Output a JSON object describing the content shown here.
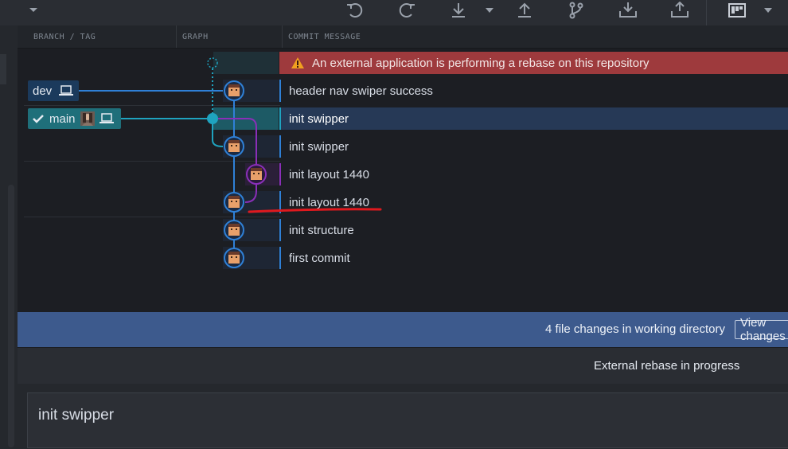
{
  "toolbar": {
    "icons": [
      "chevron-down-icon",
      "undo-icon",
      "redo-icon",
      "pull-icon",
      "push-icon",
      "branch-icon",
      "stash-icon",
      "pop-icon",
      "layout-icon"
    ]
  },
  "columns": {
    "branch_tag": "BRANCH / TAG",
    "graph": "GRAPH",
    "commit_message": "COMMIT MESSAGE"
  },
  "warning": {
    "text": "An external application is performing a rebase on this repository",
    "color": "#9e3a3d"
  },
  "branches": [
    {
      "name": "dev",
      "checked": false
    },
    {
      "name": "main",
      "checked": true
    }
  ],
  "commits": [
    {
      "message": "header nav swiper success",
      "lane": "blue"
    },
    {
      "message": "init swipper",
      "lane": "teal",
      "selected": true
    },
    {
      "message": "init swipper",
      "lane": "blue"
    },
    {
      "message": "init layout 1440",
      "lane": "purple"
    },
    {
      "message": "init layout 1440",
      "lane": "blue",
      "annotated": true
    },
    {
      "message": "init structure",
      "lane": "blue"
    },
    {
      "message": "first commit",
      "lane": "blue"
    }
  ],
  "colors": {
    "lane_blue": "#2f80d6",
    "lane_teal": "#1fa3bf",
    "lane_purple": "#8a2fb8",
    "annotation": "#e0191e",
    "status_bar": "#3d5a8d"
  },
  "status": {
    "file_changes": "4 file changes in working directory",
    "view_button": "View changes"
  },
  "rebase": {
    "text": "External rebase in progress"
  },
  "commit_input": {
    "value": "init swipper"
  }
}
